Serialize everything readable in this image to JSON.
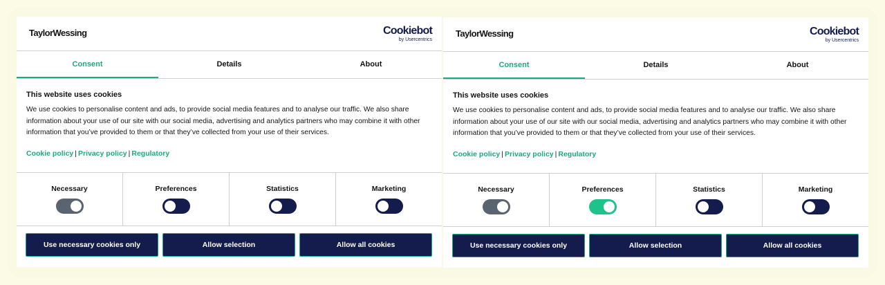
{
  "colors": {
    "accent": "#1aaa7f",
    "navy": "#141b4d",
    "toggle_on": "#1ec28b",
    "toggle_disabled": "#5a6470",
    "page_background": "#fbfbe6"
  },
  "panels": [
    {
      "brand": "TaylorWessing",
      "cookiebot": {
        "name": "Cookiebot",
        "sub": "by Usercentrics"
      },
      "tabs": [
        {
          "label": "Consent",
          "active": true
        },
        {
          "label": "Details",
          "active": false
        },
        {
          "label": "About",
          "active": false
        }
      ],
      "intro_title": "This website uses cookies",
      "intro_text": "We use cookies to personalise content and ads, to provide social media features and to analyse our traffic. We also share information about your use of our site with our social media, advertising and analytics partners who may combine it with other information that you’ve provided to them or that they’ve collected from your use of their services.",
      "links": [
        "Cookie policy",
        "Privacy policy",
        "Regulatory"
      ],
      "link_separator": "|",
      "toggles": [
        {
          "label": "Necessary",
          "state": "disabled-on"
        },
        {
          "label": "Preferences",
          "state": "off"
        },
        {
          "label": "Statistics",
          "state": "off"
        },
        {
          "label": "Marketing",
          "state": "off"
        }
      ],
      "buttons": [
        "Use necessary cookies only",
        "Allow selection",
        "Allow all cookies"
      ]
    },
    {
      "brand": "TaylorWessing",
      "cookiebot": {
        "name": "Cookiebot",
        "sub": "by Usercentrics"
      },
      "tabs": [
        {
          "label": "Consent",
          "active": true
        },
        {
          "label": "Details",
          "active": false
        },
        {
          "label": "About",
          "active": false
        }
      ],
      "intro_title": "This website uses cookies",
      "intro_text": "We use cookies to personalise content and ads, to provide social media features and to analyse our traffic. We also share information about your use of our site with our social media, advertising and analytics partners who may combine it with other information that you’ve provided to them or that they’ve collected from your use of their services.",
      "links": [
        "Cookie policy",
        "Privacy policy",
        "Regulatory"
      ],
      "link_separator": "|",
      "toggles": [
        {
          "label": "Necessary",
          "state": "disabled-on"
        },
        {
          "label": "Preferences",
          "state": "on"
        },
        {
          "label": "Statistics",
          "state": "off"
        },
        {
          "label": "Marketing",
          "state": "off"
        }
      ],
      "buttons": [
        "Use necessary cookies only",
        "Allow selection",
        "Allow all cookies"
      ]
    }
  ]
}
